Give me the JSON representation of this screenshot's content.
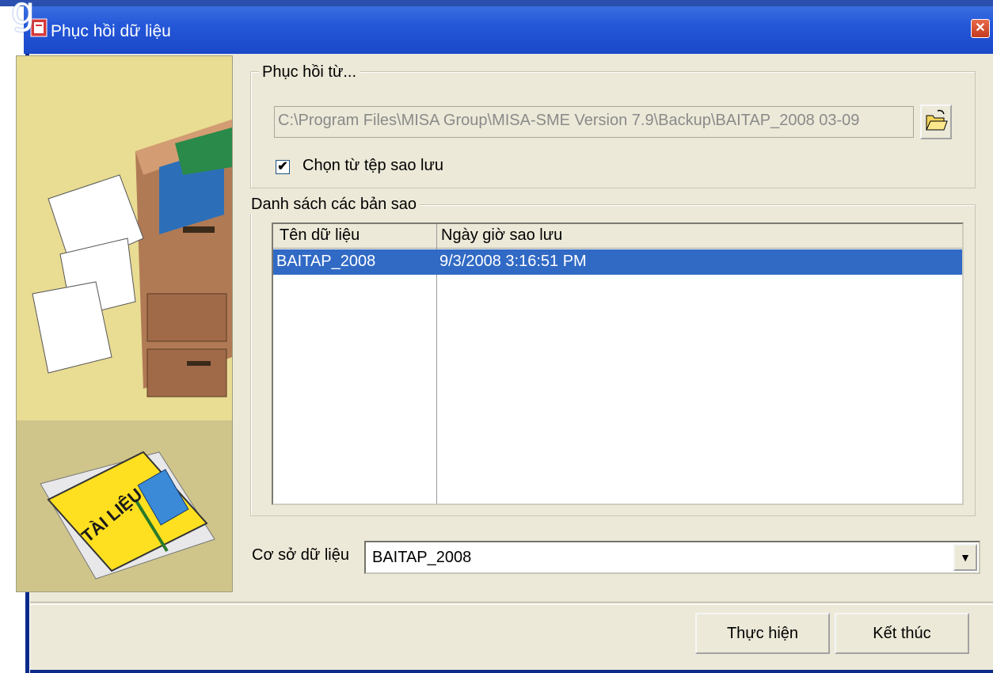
{
  "window": {
    "title": "Phục hồi dữ liệu"
  },
  "overlay_glyph": "g",
  "illustration": {
    "book_label": "TÀI LIỆU"
  },
  "restore_from": {
    "label": "Phục hồi từ...",
    "path": "C:\\Program Files\\MISA Group\\MISA-SME Version 7.9\\Backup\\BAITAP_2008 03-09",
    "checkbox_label": "Chọn từ tệp sao lưu",
    "checkbox_checked": true,
    "check_glyph": "✔"
  },
  "backup_list": {
    "label": "Danh sách các bản sao",
    "columns": [
      "Tên dữ liệu",
      "Ngày giờ sao lưu"
    ],
    "rows": [
      {
        "name": "BAITAP_2008",
        "datetime": "9/3/2008 3:16:51 PM"
      }
    ]
  },
  "database": {
    "label": "Cơ sở dữ liệu",
    "value": "BAITAP_2008",
    "arrow": "▼"
  },
  "buttons": {
    "execute": "Thực hiện",
    "finish": "Kết thúc"
  },
  "colors": {
    "titlebar": "#2457d8",
    "selection": "#316ac5",
    "dialog_bg": "#ece9d8"
  }
}
